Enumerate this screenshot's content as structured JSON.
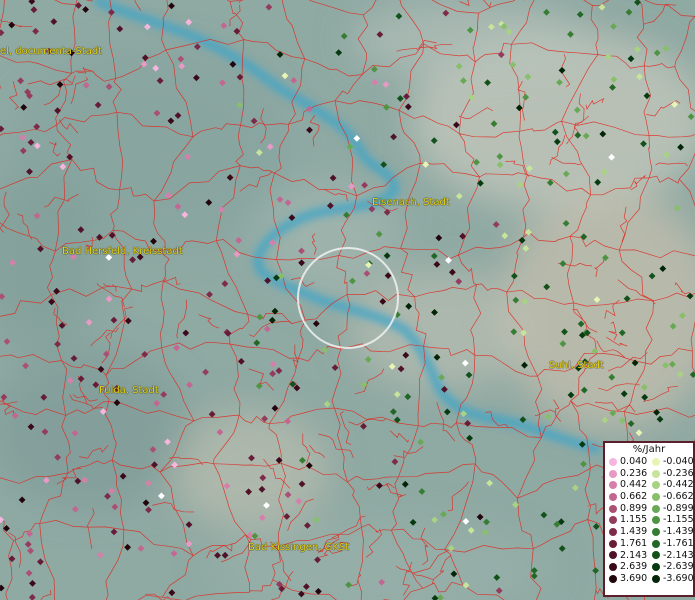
{
  "map": {
    "cities": [
      {
        "id": "documenta",
        "label": "el, documenta-Stadt"
      },
      {
        "id": "eisenach",
        "label": "Eisenach, Stadt"
      },
      {
        "id": "hersfeld",
        "label": "Bad Hersfeld, Kreisstadt"
      },
      {
        "id": "fulda",
        "label": "Fulda, Stadt"
      },
      {
        "id": "suhl",
        "label": "Suhl, Stadt"
      },
      {
        "id": "kissingen",
        "label": "Bad Kissingen, GKSt"
      }
    ]
  },
  "legend": {
    "title": "%/Jahr",
    "positive": [
      {
        "value": "0.040",
        "color": "#f5b5dc"
      },
      {
        "value": "0.236",
        "color": "#e79ac4"
      },
      {
        "value": "0.442",
        "color": "#d67fab"
      },
      {
        "value": "0.662",
        "color": "#c26791"
      },
      {
        "value": "0.899",
        "color": "#ab5075"
      },
      {
        "value": "1.155",
        "color": "#943c5e"
      },
      {
        "value": "1.439",
        "color": "#7e2a49"
      },
      {
        "value": "1.761",
        "color": "#671d37"
      },
      {
        "value": "2.143",
        "color": "#501228"
      },
      {
        "value": "2.639",
        "color": "#3a0a1a"
      },
      {
        "value": "3.690",
        "color": "#22040c"
      }
    ],
    "negative": [
      {
        "value": "-0.040",
        "color": "#e6f5b4"
      },
      {
        "value": "-0.236",
        "color": "#c7e59a"
      },
      {
        "value": "-0.442",
        "color": "#a8d382"
      },
      {
        "value": "-0.662",
        "color": "#88bf6a"
      },
      {
        "value": "-0.899",
        "color": "#69a955"
      },
      {
        "value": "-1.155",
        "color": "#4f9443"
      },
      {
        "value": "-1.439",
        "color": "#367d33"
      },
      {
        "value": "-1.761",
        "color": "#226726"
      },
      {
        "value": "-2.143",
        "color": "#13511b"
      },
      {
        "value": "-2.639",
        "color": "#073a10"
      },
      {
        "value": "-3.690",
        "color": "#012406"
      }
    ]
  }
}
